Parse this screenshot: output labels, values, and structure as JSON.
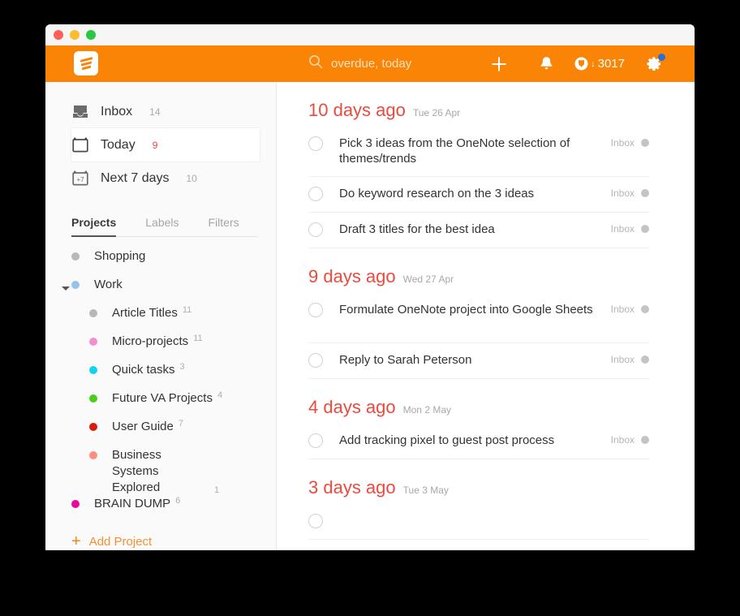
{
  "window": {
    "traffic_lights": [
      "close",
      "minimize",
      "maximize"
    ]
  },
  "header": {
    "logo_name": "todoist-logo",
    "search": {
      "value": "overdue, today",
      "placeholder": "Search"
    },
    "add_label": "+",
    "notifications_name": "bell-icon",
    "karma": {
      "arrow": "↓",
      "points": "3017"
    },
    "settings_name": "gear-icon"
  },
  "sidebar": {
    "nav": [
      {
        "icon": "inbox-icon",
        "label": "Inbox",
        "count": "14",
        "selected": false,
        "urgent": false
      },
      {
        "icon": "calendar-icon",
        "label": "Today",
        "count": "9",
        "selected": true,
        "urgent": true
      },
      {
        "icon": "calendar-7-icon",
        "label": "Next 7 days",
        "count": "10",
        "selected": false,
        "urgent": false
      }
    ],
    "tabs": [
      {
        "label": "Projects",
        "active": true
      },
      {
        "label": "Labels",
        "active": false
      },
      {
        "label": "Filters",
        "active": false
      }
    ],
    "projects": [
      {
        "label": "Shopping",
        "count": "",
        "color": "#b8b8b8",
        "indent": false,
        "caret": false
      },
      {
        "label": "Work",
        "count": "",
        "color": "#96c3eb",
        "indent": false,
        "caret": true
      },
      {
        "label": "Article Titles",
        "count": "11",
        "color": "#b8b8b8",
        "indent": true,
        "caret": false
      },
      {
        "label": "Micro-projects",
        "count": "11",
        "color": "#f48fcd",
        "indent": true,
        "caret": false
      },
      {
        "label": "Quick tasks",
        "count": "3",
        "color": "#14d3ec",
        "indent": true,
        "caret": false
      },
      {
        "label": "Future VA Projects",
        "count": "4",
        "color": "#4dcc20",
        "indent": true,
        "caret": false
      },
      {
        "label": "User Guide",
        "count": "7",
        "color": "#d81c0a",
        "indent": true,
        "caret": false
      },
      {
        "label": "Business Systems Explored",
        "count": "1",
        "color": "#fc8f7d",
        "indent": true,
        "caret": false
      },
      {
        "label": "BRAIN DUMP",
        "count": "6",
        "color": "#ec059f",
        "indent": false,
        "caret": false
      }
    ],
    "add_project": {
      "label": "Add Project",
      "plus": "+"
    }
  },
  "main": {
    "groups": [
      {
        "relative": "10 days ago",
        "date": "Tue 26 Apr",
        "tasks": [
          {
            "name": "Pick 3 ideas from the OneNote selection of themes/trends",
            "project": "Inbox",
            "tall": true
          },
          {
            "name": "Do keyword research on the 3 ideas",
            "project": "Inbox",
            "tall": false
          },
          {
            "name": "Draft 3 titles for the best idea",
            "project": "Inbox",
            "tall": false
          }
        ]
      },
      {
        "relative": "9 days ago",
        "date": "Wed 27 Apr",
        "tasks": [
          {
            "name": "Formulate OneNote project into Google Sheets",
            "project": "Inbox",
            "tall": true
          },
          {
            "name": "Reply to Sarah Peterson",
            "project": "Inbox",
            "tall": false
          }
        ]
      },
      {
        "relative": "4 days ago",
        "date": "Mon 2 May",
        "tasks": [
          {
            "name": "Add tracking pixel to guest post process",
            "project": "Inbox",
            "tall": false
          }
        ]
      },
      {
        "relative": "3 days ago",
        "date": "Tue 3 May",
        "tasks": []
      }
    ]
  },
  "colors": {
    "brand_orange": "#fa8406",
    "overdue_red": "#eb4a3f",
    "badge_blue": "#2b6fd4"
  }
}
